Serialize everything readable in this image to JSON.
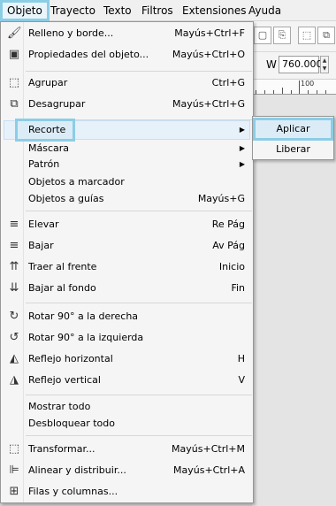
{
  "menubar": {
    "items": [
      "Objeto",
      "Trayecto",
      "Texto",
      "Filtros",
      "Extensiones",
      "Ayuda"
    ],
    "active": "Objeto"
  },
  "toolbar": {
    "width_label": "W",
    "width_value": "760.000"
  },
  "ruler": {
    "label": "100"
  },
  "menu": {
    "relleno": {
      "label": "Relleno y borde...",
      "shortcut": "Mayús+Ctrl+F",
      "icon": "paintbrush-icon"
    },
    "propiedades": {
      "label": "Propiedades del objeto...",
      "shortcut": "Mayús+Ctrl+O",
      "icon": "object-properties-icon"
    },
    "agrupar": {
      "label": "Agrupar",
      "shortcut": "Ctrl+G",
      "icon": "group-icon"
    },
    "desagrupar": {
      "label": "Desagrupar",
      "shortcut": "Mayús+Ctrl+G",
      "icon": "ungroup-icon"
    },
    "recorte": {
      "label": "Recorte"
    },
    "mascara": {
      "label": "Máscara"
    },
    "patron": {
      "label": "Patrón"
    },
    "obj_marcador": {
      "label": "Objetos a marcador"
    },
    "obj_guias": {
      "label": "Objetos a guías",
      "shortcut": "Mayús+G"
    },
    "elevar": {
      "label": "Elevar",
      "shortcut": "Re Pág",
      "icon": "raise-icon"
    },
    "bajar": {
      "label": "Bajar",
      "shortcut": "Av Pág",
      "icon": "lower-icon"
    },
    "traer_frente": {
      "label": "Traer al frente",
      "shortcut": "Inicio",
      "icon": "raise-to-top-icon"
    },
    "bajar_fondo": {
      "label": "Bajar al fondo",
      "shortcut": "Fin",
      "icon": "lower-to-bottom-icon"
    },
    "rotar_der": {
      "label": "Rotar 90° a la derecha",
      "icon": "rotate-cw-icon"
    },
    "rotar_izq": {
      "label": "Rotar 90° a la izquierda",
      "icon": "rotate-ccw-icon"
    },
    "reflejo_h": {
      "label": "Reflejo horizontal",
      "shortcut": "H",
      "icon": "flip-horizontal-icon"
    },
    "reflejo_v": {
      "label": "Reflejo vertical",
      "shortcut": "V",
      "icon": "flip-vertical-icon"
    },
    "mostrar": {
      "label": "Mostrar todo"
    },
    "desbloquear": {
      "label": "Desbloquear todo"
    },
    "transformar": {
      "label": "Transformar...",
      "shortcut": "Mayús+Ctrl+M",
      "icon": "transform-icon"
    },
    "alinear": {
      "label": "Alinear y distribuir...",
      "shortcut": "Mayús+Ctrl+A",
      "icon": "align-icon"
    },
    "filas": {
      "label": "Filas y columnas...",
      "icon": "grid-icon"
    }
  },
  "submenu": {
    "aplicar": "Aplicar",
    "liberar": "Liberar"
  },
  "colors": {
    "highlight_border": "#8ccde6",
    "highlight_fill": "#dcecf7"
  }
}
